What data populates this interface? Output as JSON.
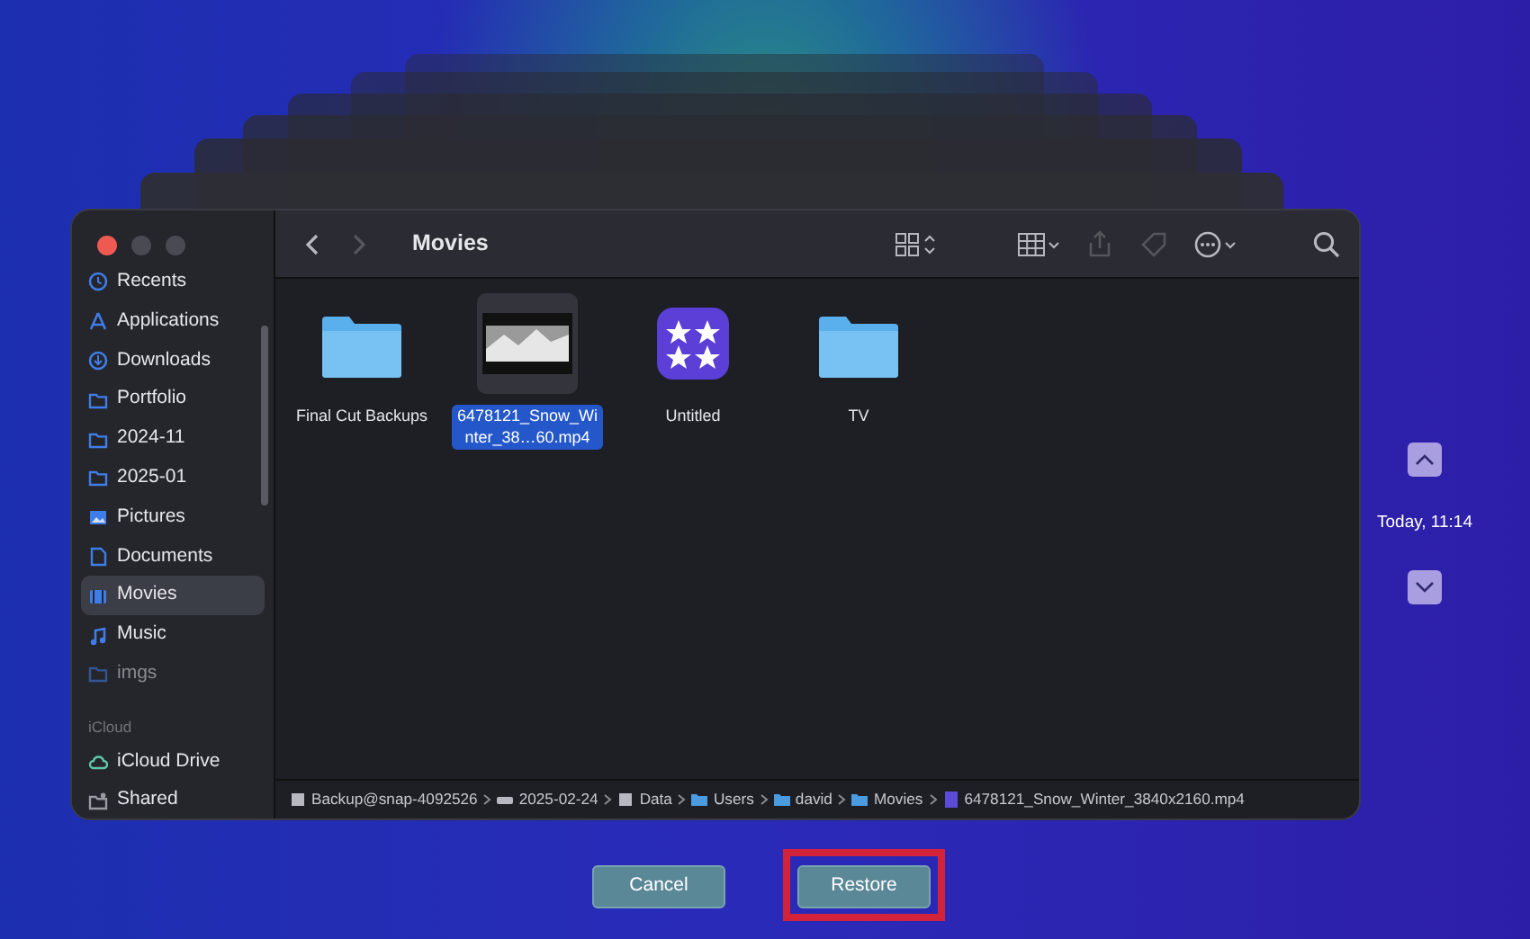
{
  "window": {
    "title": "Movies"
  },
  "sidebar": {
    "items": [
      {
        "label": "Recents",
        "kind": "clock",
        "selected": false,
        "disabled": false
      },
      {
        "label": "Applications",
        "kind": "apps",
        "selected": false,
        "disabled": false
      },
      {
        "label": "Downloads",
        "kind": "download",
        "selected": false,
        "disabled": false
      },
      {
        "label": "Portfolio",
        "kind": "folder",
        "selected": false,
        "disabled": false
      },
      {
        "label": "2024-11",
        "kind": "folder",
        "selected": false,
        "disabled": false
      },
      {
        "label": "2025-01",
        "kind": "folder",
        "selected": false,
        "disabled": false
      },
      {
        "label": "Pictures",
        "kind": "picture",
        "selected": false,
        "disabled": false
      },
      {
        "label": "Documents",
        "kind": "document",
        "selected": false,
        "disabled": false
      },
      {
        "label": "Movies",
        "kind": "film",
        "selected": true,
        "disabled": false
      },
      {
        "label": "Music",
        "kind": "music",
        "selected": false,
        "disabled": false
      },
      {
        "label": "imgs",
        "kind": "folder",
        "selected": false,
        "disabled": true
      }
    ],
    "icloud": {
      "heading": "iCloud",
      "items": [
        {
          "label": "iCloud Drive",
          "kind": "cloud",
          "selected": false,
          "disabled": false
        },
        {
          "label": "Shared",
          "kind": "shared",
          "selected": false,
          "disabled": false
        }
      ]
    }
  },
  "files": [
    {
      "name": "Final Cut Backups",
      "kind": "folder",
      "selected": false
    },
    {
      "name": "6478121_Snow_Winter_38…60.mp4",
      "kind": "video",
      "selected": true
    },
    {
      "name": "Untitled",
      "kind": "app",
      "selected": false
    },
    {
      "name": "TV",
      "kind": "folder",
      "selected": false
    }
  ],
  "path_bar": [
    {
      "label": "Backup@snap-4092526",
      "kind": "disk"
    },
    {
      "label": "2025-02-24",
      "kind": "drive"
    },
    {
      "label": "Data",
      "kind": "disk"
    },
    {
      "label": "Users",
      "kind": "folder"
    },
    {
      "label": "david",
      "kind": "folder"
    },
    {
      "label": "Movies",
      "kind": "folder"
    },
    {
      "label": "6478121_Snow_Winter_3840x2160.mp4",
      "kind": "video"
    }
  ],
  "timeline": {
    "label": "Today, 11:14"
  },
  "buttons": [
    {
      "label": "Cancel",
      "highlighted": false
    },
    {
      "label": "Restore",
      "highlighted": true
    }
  ]
}
